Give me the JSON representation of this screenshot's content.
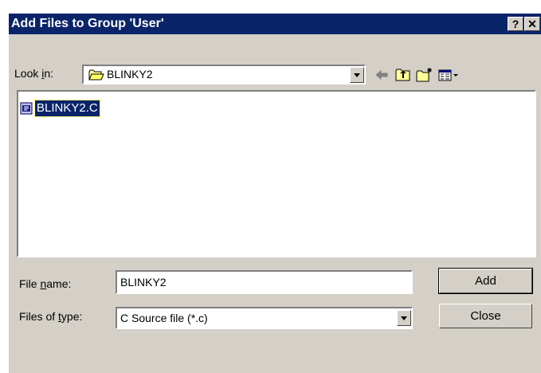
{
  "dialog": {
    "title": "Add Files to Group 'User'",
    "help_button": "?",
    "close_button": "✕"
  },
  "look_in": {
    "label_pre": "Look ",
    "label_hotkey": "i",
    "label_post": "n:",
    "value": "BLINKY2",
    "icons": [
      "back-arrow-icon",
      "up-folder-icon",
      "new-folder-icon",
      "view-menu-icon"
    ]
  },
  "file_list": {
    "items": [
      {
        "name": "BLINKY2.C",
        "selected": true
      }
    ]
  },
  "file_name": {
    "label_pre": "File ",
    "label_hotkey": "n",
    "label_post": "ame:",
    "value": "BLINKY2"
  },
  "file_type": {
    "label_pre": "Files of ",
    "label_hotkey": "t",
    "label_post": "ype:",
    "value": "C Source file (*.c)"
  },
  "buttons": {
    "add": "Add",
    "close": "Close"
  },
  "colors": {
    "title_bar": "#0a246a",
    "dialog_face": "#d4d0c8",
    "selection": "#0a246a"
  }
}
